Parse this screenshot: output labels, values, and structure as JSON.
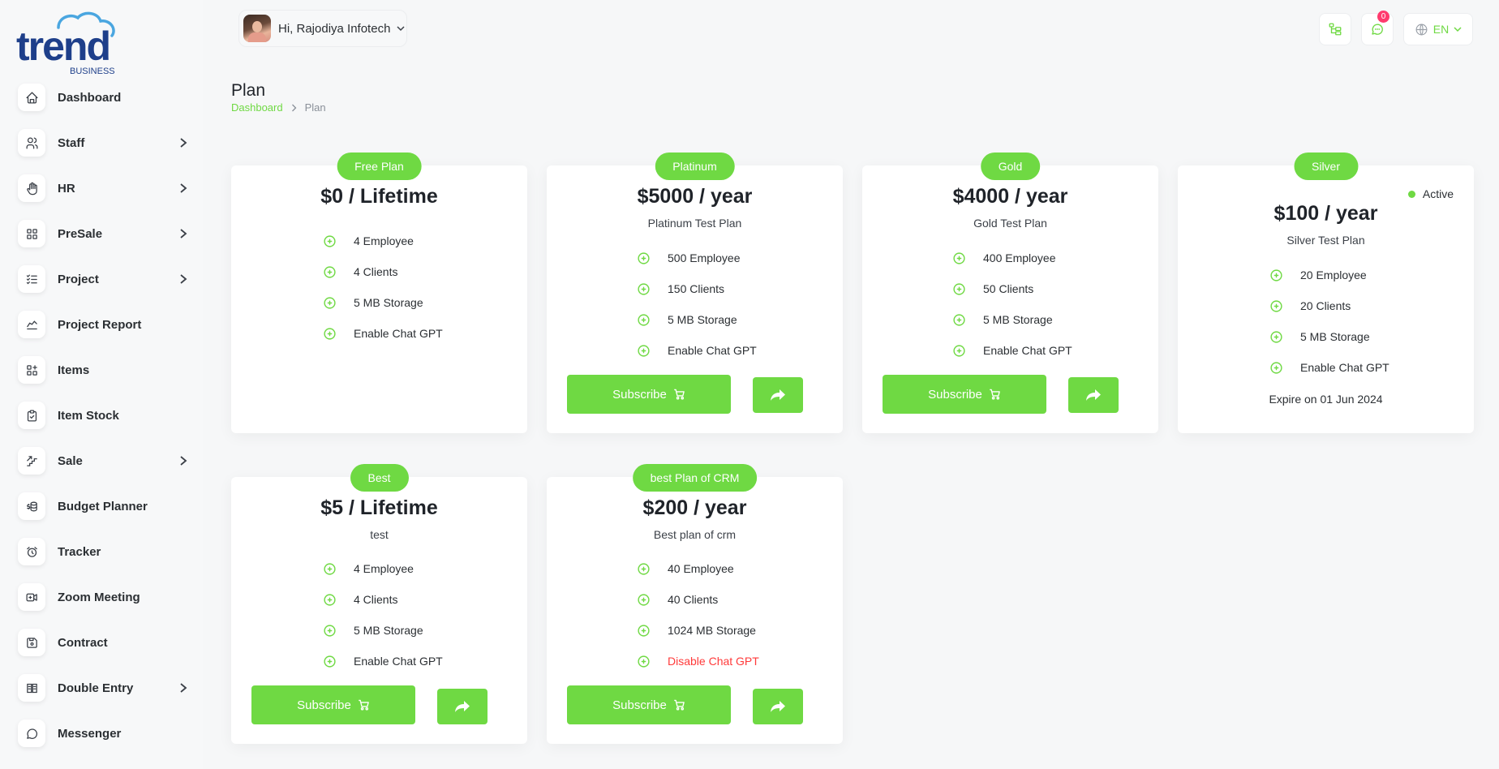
{
  "brand": {
    "logo_text": "trend",
    "logo_sub": "BUSINESS"
  },
  "sidebar": {
    "items": [
      {
        "label": "Dashboard",
        "icon": "home-icon",
        "has_children": false
      },
      {
        "label": "Staff",
        "icon": "users-icon",
        "has_children": true
      },
      {
        "label": "HR",
        "icon": "hand-icon",
        "has_children": true
      },
      {
        "label": "PreSale",
        "icon": "grid-icon",
        "has_children": true
      },
      {
        "label": "Project",
        "icon": "list-check-icon",
        "has_children": true
      },
      {
        "label": "Project Report",
        "icon": "chart-line-icon",
        "has_children": false
      },
      {
        "label": "Items",
        "icon": "apps-plus-icon",
        "has_children": false
      },
      {
        "label": "Item Stock",
        "icon": "clipboard-check-icon",
        "has_children": false
      },
      {
        "label": "Sale",
        "icon": "steps-icon",
        "has_children": true
      },
      {
        "label": "Budget Planner",
        "icon": "coins-icon",
        "has_children": false
      },
      {
        "label": "Tracker",
        "icon": "alarm-icon",
        "has_children": false
      },
      {
        "label": "Zoom Meeting",
        "icon": "video-icon",
        "has_children": false
      },
      {
        "label": "Contract",
        "icon": "device-floppy-icon",
        "has_children": false
      },
      {
        "label": "Double Entry",
        "icon": "scale-icon",
        "has_children": true
      },
      {
        "label": "Messenger",
        "icon": "message-icon",
        "has_children": false
      }
    ]
  },
  "header": {
    "greeting": "Hi, Rajodiya Infotech",
    "notification_count": "0",
    "language": "EN"
  },
  "page": {
    "title": "Plan",
    "breadcrumb": {
      "home": "Dashboard",
      "current": "Plan"
    }
  },
  "plans": [
    {
      "name": "Free Plan",
      "price": "$0 / Lifetime",
      "subtitle": "",
      "features": [
        "4 Employee",
        "4 Clients",
        "5 MB Storage",
        "Enable Chat GPT"
      ],
      "feature_disabled": [
        false,
        false,
        false,
        false
      ],
      "subscribe_label": "Subscribe",
      "show_actions": false,
      "active": false
    },
    {
      "name": "Platinum",
      "price": "$5000 / year",
      "subtitle": "Platinum Test Plan",
      "features": [
        "500 Employee",
        "150 Clients",
        "5 MB Storage",
        "Enable Chat GPT"
      ],
      "feature_disabled": [
        false,
        false,
        false,
        false
      ],
      "subscribe_label": "Subscribe",
      "show_actions": true,
      "active": false
    },
    {
      "name": "Gold",
      "price": "$4000 / year",
      "subtitle": "Gold Test Plan",
      "features": [
        "400 Employee",
        "50 Clients",
        "5 MB Storage",
        "Enable Chat GPT"
      ],
      "feature_disabled": [
        false,
        false,
        false,
        false
      ],
      "subscribe_label": "Subscribe",
      "show_actions": true,
      "active": false
    },
    {
      "name": "Silver",
      "price": "$100 / year",
      "subtitle": "Silver Test Plan",
      "features": [
        "20 Employee",
        "20 Clients",
        "5 MB Storage",
        "Enable Chat GPT"
      ],
      "feature_disabled": [
        false,
        false,
        false,
        false
      ],
      "status": "Active",
      "expire": "Expire on 01 Jun 2024",
      "show_actions": false,
      "active": true
    },
    {
      "name": "Best",
      "price": "$5 / Lifetime",
      "subtitle": "test",
      "features": [
        "4 Employee",
        "4 Clients",
        "5 MB Storage",
        "Enable Chat GPT"
      ],
      "feature_disabled": [
        false,
        false,
        false,
        false
      ],
      "subscribe_label": "Subscribe",
      "show_actions": true,
      "active": false
    },
    {
      "name": "best Plan of CRM",
      "price": "$200 / year",
      "subtitle": "Best plan of crm",
      "features": [
        "40 Employee",
        "40 Clients",
        "1024 MB Storage",
        "Disable Chat GPT"
      ],
      "feature_disabled": [
        false,
        false,
        false,
        true
      ],
      "subscribe_label": "Subscribe",
      "show_actions": true,
      "active": false
    }
  ],
  "colors": {
    "accent": "#6fd943",
    "danger": "#ff3a3a",
    "badge": "#ff3a6e"
  }
}
